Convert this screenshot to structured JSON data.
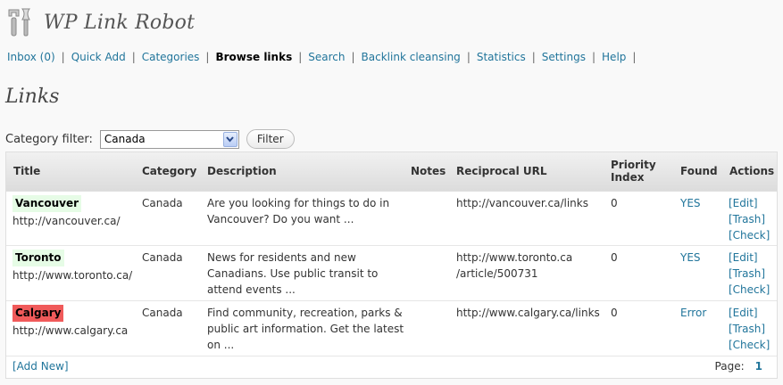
{
  "app": {
    "title": "WP Link Robot",
    "icon": "tools-icon"
  },
  "nav": {
    "items": [
      {
        "label": "Inbox (0)",
        "current": false
      },
      {
        "label": "Quick Add",
        "current": false
      },
      {
        "label": "Categories",
        "current": false
      },
      {
        "label": "Browse links",
        "current": true
      },
      {
        "label": "Search",
        "current": false
      },
      {
        "label": "Backlink cleansing",
        "current": false
      },
      {
        "label": "Statistics",
        "current": false
      },
      {
        "label": "Settings",
        "current": false
      },
      {
        "label": "Help",
        "current": false
      }
    ],
    "separator": "|"
  },
  "page": {
    "heading": "Links"
  },
  "filter": {
    "label": "Category filter:",
    "selected": "Canada",
    "button_label": "Filter"
  },
  "table": {
    "columns": [
      "Title",
      "Category",
      "Description",
      "Notes",
      "Reciprocal URL",
      "Priority Index",
      "Found",
      "Actions"
    ],
    "rows": [
      {
        "title": "Vancouver",
        "title_bg": "#e6fce6",
        "url": "http://vancouver.ca/",
        "category": "Canada",
        "description": [
          "Are you looking for things to do in",
          "Vancouver? Do you want ..."
        ],
        "notes": "",
        "reciprocal_url": [
          "http://vancouver.ca/links"
        ],
        "priority": "0",
        "found": "YES",
        "actions": [
          "[Edit]",
          "[Trash]",
          "[Check]"
        ]
      },
      {
        "title": "Toronto",
        "title_bg": "#e6fce6",
        "url": "http://www.toronto.ca/",
        "category": "Canada",
        "description": [
          "News for residents and new",
          "Canadians. Use public transit to",
          "attend events ..."
        ],
        "notes": "",
        "reciprocal_url": [
          "http://www.toronto.ca",
          "/article/500731"
        ],
        "priority": "0",
        "found": "YES",
        "actions": [
          "[Edit]",
          "[Trash]",
          "[Check]"
        ]
      },
      {
        "title": "Calgary",
        "title_bg": "#f05a5a",
        "url": "http://www.calgary.ca",
        "category": "Canada",
        "description": [
          "Find community, recreation, parks &",
          "public art information. Get the latest",
          "on ..."
        ],
        "notes": "",
        "reciprocal_url": [
          "http://www.calgary.ca/links"
        ],
        "priority": "0",
        "found": "Error",
        "actions": [
          "[Edit]",
          "[Trash]",
          "[Check]"
        ]
      }
    ],
    "add_new_label": "[Add New]",
    "pager_label": "Page:",
    "current_page": "1"
  }
}
